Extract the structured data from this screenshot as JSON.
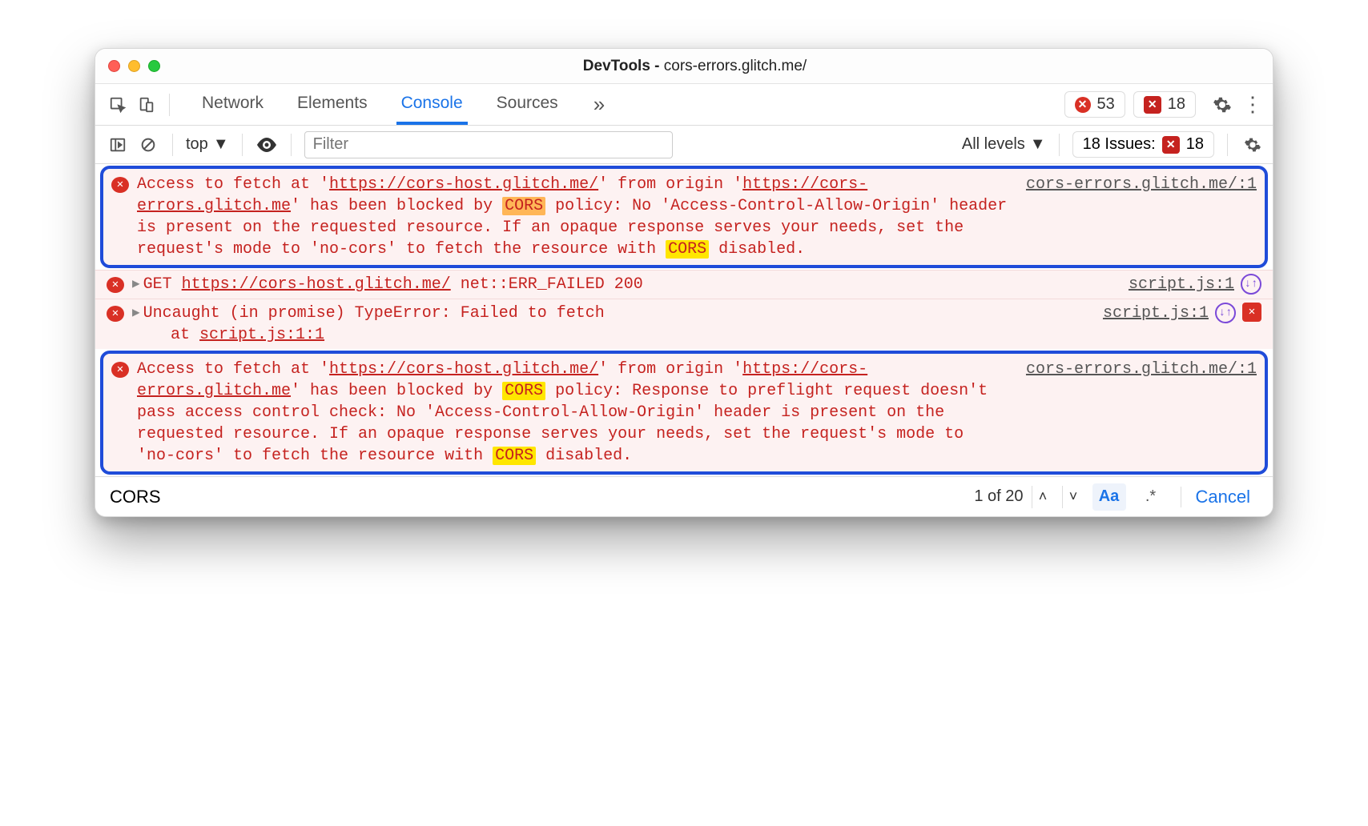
{
  "window": {
    "title_prefix": "DevTools - ",
    "title_url": "cors-errors.glitch.me/"
  },
  "main_toolbar": {
    "tabs": [
      "Network",
      "Elements",
      "Console",
      "Sources"
    ],
    "active_tab": "Console",
    "error_count": "53",
    "issue_count": "18"
  },
  "sub_toolbar": {
    "context": "top",
    "filter_placeholder": "Filter",
    "levels": "All levels",
    "issues_label": "18 Issues:",
    "issues_count": "18"
  },
  "messages": [
    {
      "type": "error",
      "highlight": true,
      "text_parts": [
        {
          "t": "Access to fetch at '"
        },
        {
          "t": "https://cors-host.glitch.me/",
          "u": true
        },
        {
          "t": "' from origin '"
        },
        {
          "t": "https://cors-errors.glitch.me",
          "u": true
        },
        {
          "t": "' has been blocked by "
        },
        {
          "t": "CORS",
          "mk": "orange"
        },
        {
          "t": " policy: No 'Access-Control-Allow-Origin' header is present on the requested resource. If an opaque response serves your needs, set the request's mode to 'no-cors' to fetch the resource with "
        },
        {
          "t": "CORS",
          "mk": "yellow"
        },
        {
          "t": " disabled."
        }
      ],
      "source": "cors-errors.glitch.me/:1"
    },
    {
      "type": "error",
      "disclosure": true,
      "nav_icon": true,
      "text_parts": [
        {
          "t": "GET "
        },
        {
          "t": "https://cors-host.glitch.me/",
          "u": true
        },
        {
          "t": " net::ERR_FAILED 200"
        }
      ],
      "source": "script.js:1"
    },
    {
      "type": "error",
      "disclosure": true,
      "nav_icon": true,
      "err_box": true,
      "text_parts": [
        {
          "t": "Uncaught (in promise) TypeError: Failed to fetch\n    at "
        },
        {
          "t": "script.js:1:1",
          "u": true
        }
      ],
      "source": "script.js:1"
    },
    {
      "type": "error",
      "highlight": true,
      "text_parts": [
        {
          "t": "Access to fetch at '"
        },
        {
          "t": "https://cors-host.glitch.me/",
          "u": true
        },
        {
          "t": "' from origin '"
        },
        {
          "t": "https://cors-errors.glitch.me",
          "u": true
        },
        {
          "t": "' has been blocked by "
        },
        {
          "t": "CORS",
          "mk": "yellow"
        },
        {
          "t": " policy: Response to preflight request doesn't pass access control check: No 'Access-Control-Allow-Origin' header is present on the requested resource. If an opaque response serves your needs, set the request's mode to 'no-cors' to fetch the resource with "
        },
        {
          "t": "CORS",
          "mk": "yellow"
        },
        {
          "t": " disabled."
        }
      ],
      "source": "cors-errors.glitch.me/:1"
    }
  ],
  "search": {
    "query": "CORS",
    "match_label": "1 of 20",
    "case_label": "Aa",
    "regex_label": ".*",
    "cancel_label": "Cancel"
  }
}
